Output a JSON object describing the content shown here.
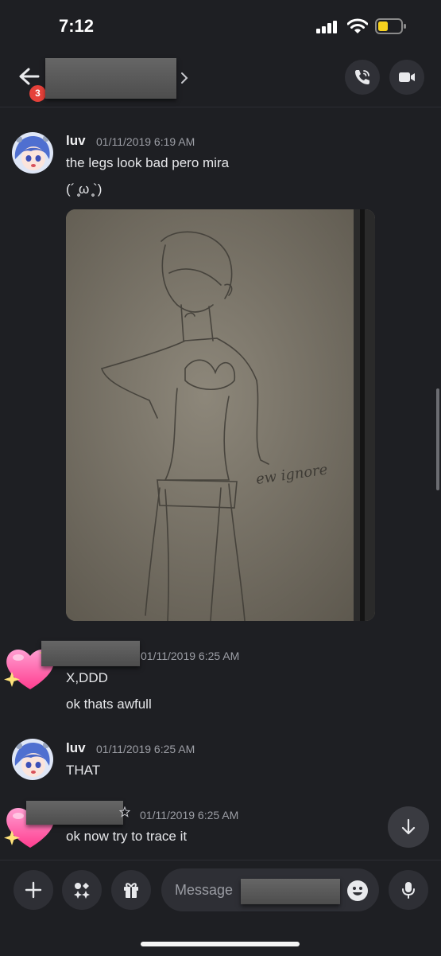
{
  "status_bar": {
    "time": "7:12"
  },
  "header": {
    "unread_count": "3"
  },
  "messages": [
    {
      "author": "luv",
      "timestamp": "01/11/2019 6:19 AM",
      "lines": [
        "the legs look bad pero mira",
        "(´ ̥̥̥ω ̥̥̥`)"
      ],
      "attachment_text": "ew ignore"
    },
    {
      "author": "",
      "timestamp": "01/11/2019 6:25 AM",
      "lines": [
        "X,DDD",
        "ok thats awfull"
      ]
    },
    {
      "author": "luv",
      "timestamp": "01/11/2019 6:25 AM",
      "lines": [
        "THAT"
      ]
    },
    {
      "author": "",
      "timestamp": "01/11/2019 6:25 AM",
      "lines": [
        "ok now try to trace it"
      ]
    }
  ],
  "composer": {
    "placeholder": "Message"
  },
  "icons": [
    "arrow-left-icon",
    "chevron-right-icon",
    "phone-icon",
    "video-camera-icon",
    "plus-icon",
    "apps-icon",
    "gift-icon",
    "emoji-icon",
    "microphone-icon",
    "arrow-down-icon",
    "sparkle-heart-icon"
  ],
  "colors": {
    "background": "#1e1f23",
    "badge": "#e5413a",
    "battery": "#f7d21e",
    "heart": "#ff4fa0"
  }
}
